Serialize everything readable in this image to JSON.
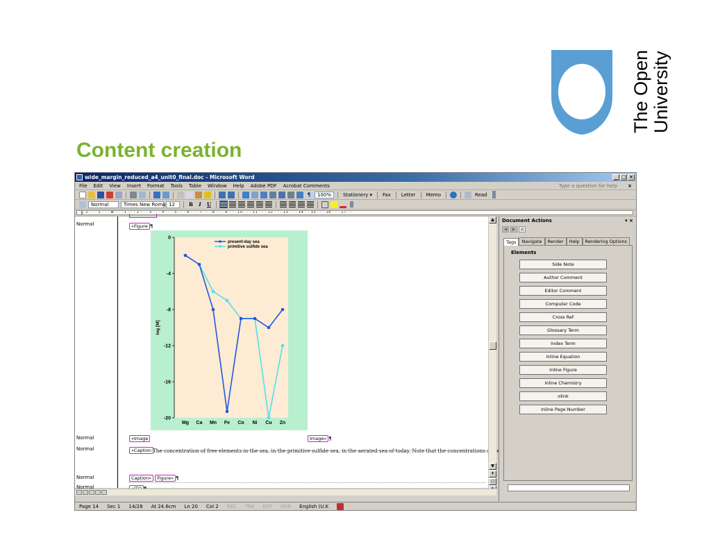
{
  "slide": {
    "title": "Content creation",
    "logo_lines": [
      "The Open",
      "University"
    ]
  },
  "window": {
    "title": "wide_margin_reduced_a4_unit0_final.doc - Microsoft Word",
    "controls": [
      "_",
      "□",
      "×"
    ]
  },
  "menubar": {
    "items": [
      "File",
      "Edit",
      "View",
      "Insert",
      "Format",
      "Tools",
      "Table",
      "Window",
      "Help",
      "Adobe PDF",
      "Acrobat Comments"
    ],
    "help_placeholder": "Type a question for help",
    "close": "×"
  },
  "toolbar_standard": {
    "zoom": "100%",
    "buttons": [
      "Stationery ▾",
      "Fax",
      "Letter",
      "Memo",
      "Read"
    ]
  },
  "toolbar_formatting": {
    "style": "Normal",
    "font": "Times New Roman",
    "size": "12",
    "bold": "B",
    "italic": "I",
    "underline": "U"
  },
  "ruler": {
    "text": "· 2 · · · 1 · · · ⊠ · · · 1 · · · 2 · · · 3 · · · 4 · · · 5 · · · 6 · · · 7 · · · 8 · · · 9 · · · 10 · · · 11 · · · 12 · · · 13 · · · 14 · · 15 · · · 16 · · · 17 · ·"
  },
  "document": {
    "style_labels": [
      "Normal",
      "Normal",
      "Normal",
      "Normal",
      "Normal"
    ],
    "tags": {
      "figure_open": "«Figure",
      "image_open": "«Image",
      "image_close": "Image»",
      "caption_open": "«Caption",
      "caption_close": "Caption»",
      "figure_close": "Figure»",
      "itq_open": "«ITQ"
    },
    "pilcrow": "¶",
    "caption_text": "The·concentration·of·free·elements·in·the·sea,·in·the·primitive·sulfide·sea,·in·the·aerated·sea·of·today.·Note·that·the·concentrations·are·expressed·on·a·logarithmic·scale·(not·linear).¶"
  },
  "chart_data": {
    "type": "line",
    "categories": [
      "Mg",
      "Ca",
      "Mn",
      "Fe",
      "Co",
      "Ni",
      "Cu",
      "Zn"
    ],
    "series": [
      {
        "name": "present-day sea",
        "color": "#1f57e0",
        "values": [
          -2,
          -3,
          -8,
          -19.3,
          -9,
          -9,
          -10,
          -8
        ]
      },
      {
        "name": "primitive sulfide sea",
        "color": "#4ee0f0",
        "values": [
          -2,
          -3,
          -6,
          -7,
          -9,
          -9,
          -20,
          -12
        ]
      }
    ],
    "ylabel": "log [M]",
    "ylim": [
      -20,
      0
    ],
    "yticks": [
      "0",
      "-4",
      "-8",
      "-12",
      "-16",
      "-20"
    ],
    "legend": "top-right",
    "plot_bg": "#fdebd3",
    "figure_bg": "#b8f0cf"
  },
  "statusbar": {
    "page": "Page 14",
    "sec": "Sec 1",
    "pages": "14/28",
    "at": "At 24.6cm",
    "ln": "Ln 20",
    "col": "Col 2",
    "modes": [
      "REC",
      "TRK",
      "EXT",
      "OVR"
    ],
    "language": "English (U.K"
  },
  "taskpane": {
    "title": "Document Actions",
    "close": "▾ ×",
    "tabs": [
      "Tags",
      "Navigate",
      "Render",
      "Help",
      "Rendering Options"
    ],
    "section": "Elements",
    "buttons": [
      "Side Note",
      "Author Comment",
      "Editor Comment",
      "Computer Code",
      "Cross Ref",
      "Glossary Term",
      "Index Term",
      "Inline Equation",
      "Inline Figure",
      "Inline Chemistry",
      "olink",
      "Inline Page Number"
    ]
  },
  "colors": {
    "title_green": "#7ab32e",
    "logo_blue": "#5a9fd4"
  }
}
